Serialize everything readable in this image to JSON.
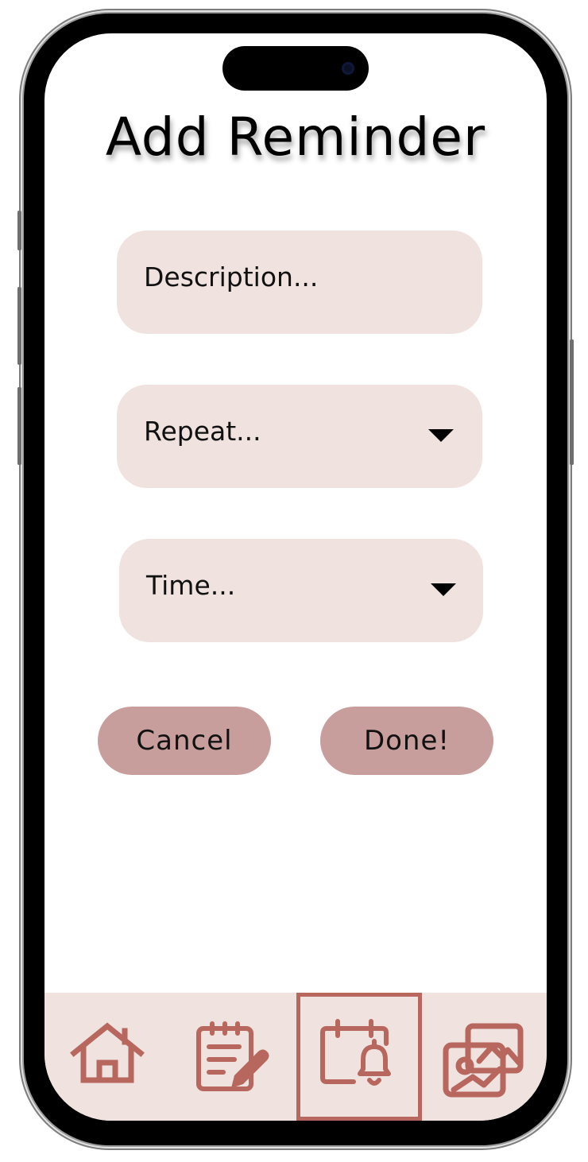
{
  "colors": {
    "field_bg": "#efe2df",
    "button_bg": "#c79e9c",
    "navbar_bg": "#efe2df",
    "icon": "#b8675f"
  },
  "screen": {
    "title": "Add Reminder"
  },
  "form": {
    "description_placeholder": "Description...",
    "repeat_placeholder": "Repeat...",
    "time_placeholder": "Time..."
  },
  "actions": {
    "cancel_label": "Cancel",
    "done_label": "Done!"
  },
  "navbar": {
    "items": [
      {
        "icon": "home-icon",
        "active": false
      },
      {
        "icon": "notes-edit-icon",
        "active": false
      },
      {
        "icon": "calendar-bell-icon",
        "active": true
      },
      {
        "icon": "photo-gallery-icon",
        "active": false
      }
    ]
  }
}
